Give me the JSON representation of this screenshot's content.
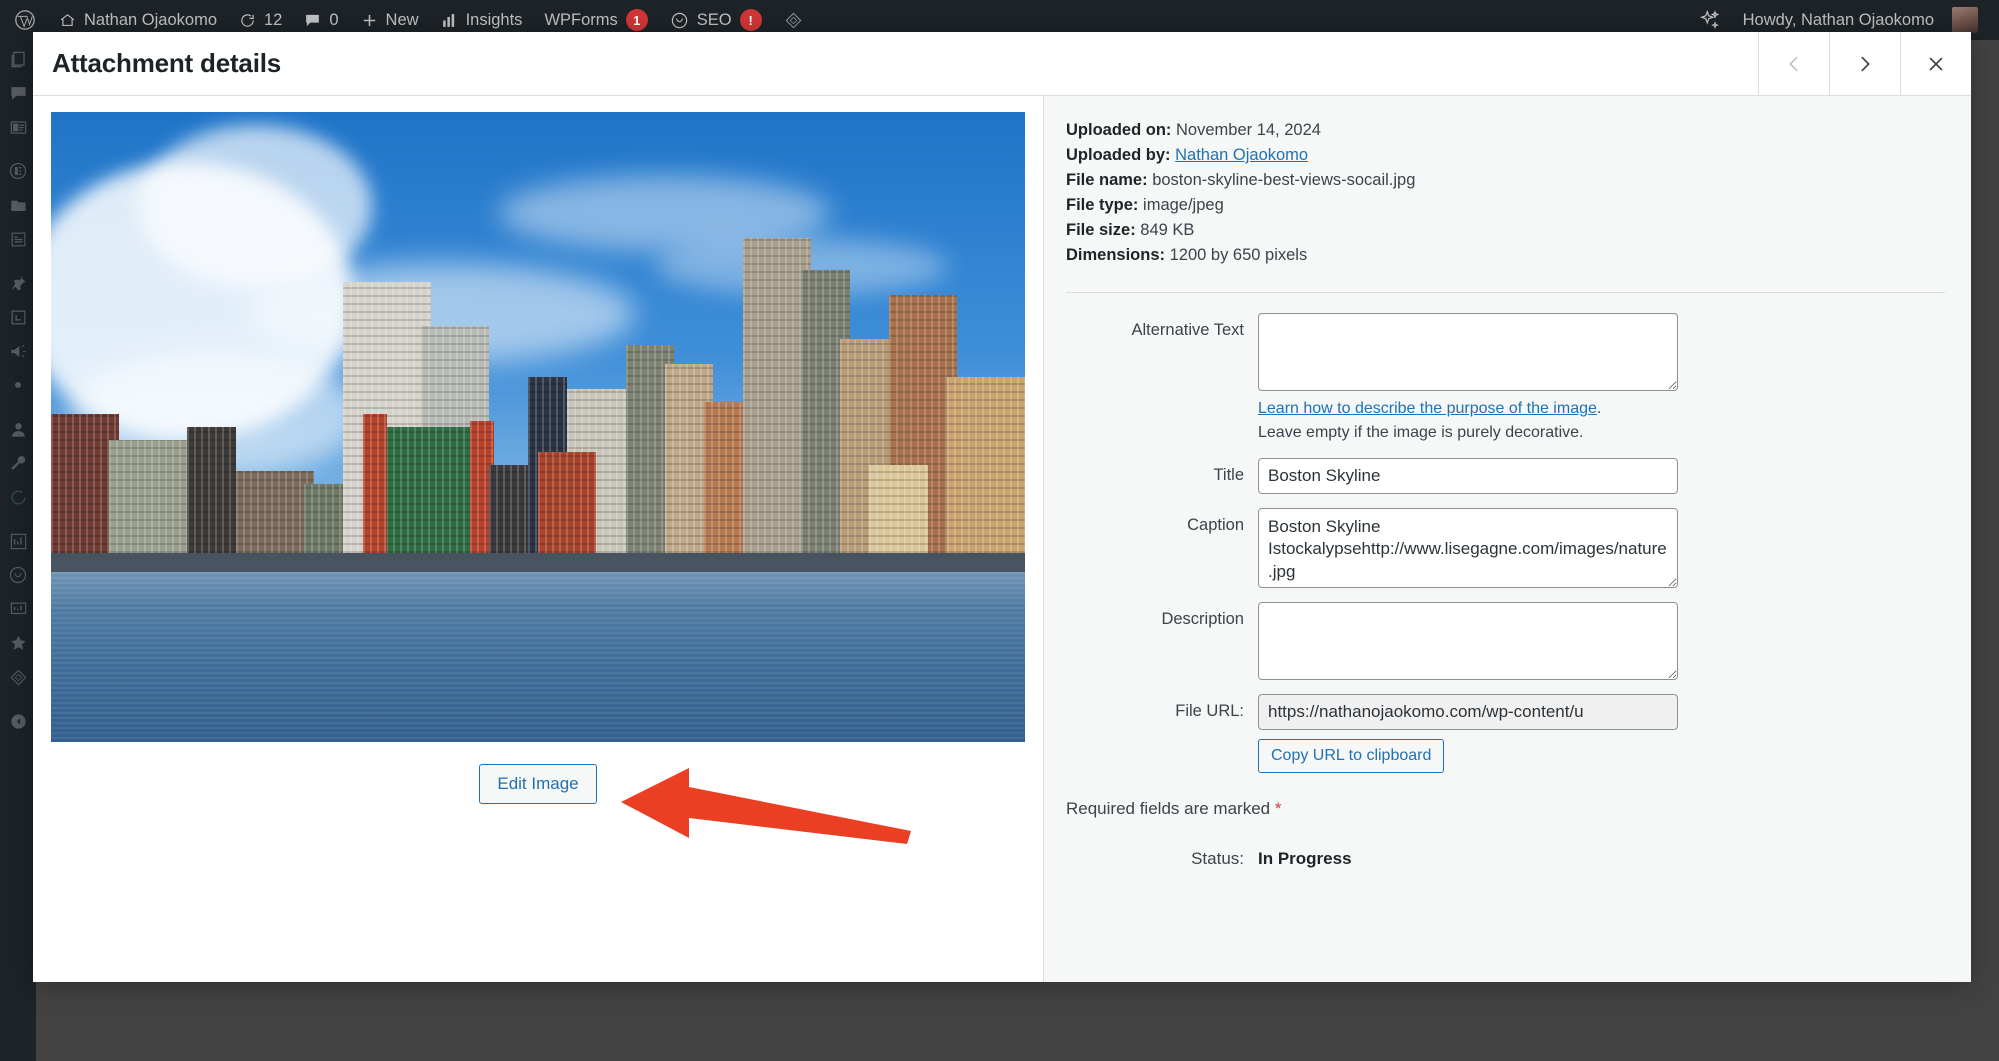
{
  "adminbar": {
    "logo_icon": "wordpress-logo-icon",
    "items": [
      {
        "icon": "home-icon",
        "label": "Nathan Ojaokomo",
        "badge": null
      },
      {
        "icon": "updates-icon",
        "label": "12",
        "badge": null
      },
      {
        "icon": "comment-icon",
        "label": "0",
        "badge": null
      },
      {
        "icon": "plus-icon",
        "label": "New",
        "badge": null
      },
      {
        "icon": "bar-chart-icon",
        "label": "Insights",
        "badge": null
      },
      {
        "icon": null,
        "label": "WPForms",
        "badge": "1"
      },
      {
        "icon": "seo-icon",
        "label": "SEO",
        "badge": "!"
      },
      {
        "icon": "diamond-icon",
        "label": "",
        "badge": null
      }
    ],
    "right": {
      "sparkle_icon": "sparkle-icon",
      "greeting": "Howdy, Nathan Ojaokomo",
      "avatar": "avatar"
    }
  },
  "adminmenu": {
    "items": [
      "pages-icon",
      "comments-icon",
      "forms-icon",
      "elementor-icon",
      "media-icon",
      "list-icon",
      "plugins-icon",
      "appearance-icon",
      "marketing-icon",
      "dot-icon",
      "users-icon",
      "tools-icon",
      "loading-icon",
      "analytics-icon",
      "seo-menu-icon",
      "stats-icon",
      "optimize-icon",
      "diamond-menu-icon",
      "collapse-icon"
    ]
  },
  "modal": {
    "title": "Attachment details",
    "prev_icon": "chevron-left-icon",
    "next_icon": "chevron-right-icon",
    "close_icon": "close-icon",
    "prev_disabled": true
  },
  "preview": {
    "image_alt": "Boston skyline waterfront photograph",
    "edit_button": "Edit Image",
    "annotation_arrow": "red-arrow-annotation"
  },
  "details": {
    "meta": [
      {
        "label": "Uploaded on:",
        "value": "November 14, 2024",
        "link": false
      },
      {
        "label": "Uploaded by:",
        "value": "Nathan Ojaokomo",
        "link": true
      },
      {
        "label": "File name:",
        "value": "boston-skyline-best-views-socail.jpg",
        "link": false
      },
      {
        "label": "File type:",
        "value": "image/jpeg",
        "link": false
      },
      {
        "label": "File size:",
        "value": "849 KB",
        "link": false
      },
      {
        "label": "Dimensions:",
        "value": "1200 by 650 pixels",
        "link": false
      }
    ],
    "fields": {
      "alt_text": {
        "label": "Alternative Text",
        "value": "",
        "placeholder": ""
      },
      "alt_helper_link": "Learn how to describe the purpose of the image",
      "alt_helper_tail": ".",
      "alt_helper_note": "Leave empty if the image is purely decorative.",
      "title": {
        "label": "Title",
        "value": "Boston Skyline"
      },
      "caption": {
        "label": "Caption",
        "value": "Boston Skyline Istockalypsehttp://www.lisegagne.com/images/nature.jpg"
      },
      "description": {
        "label": "Description",
        "value": ""
      },
      "file_url": {
        "label": "File URL:",
        "value": "https://nathanojaokomo.com/wp-content/u"
      },
      "copy_button": "Copy URL to clipboard"
    },
    "required_note": "Required fields are marked",
    "required_mark": "*",
    "status": {
      "label": "Status:",
      "value": "In Progress"
    }
  },
  "colors": {
    "admin_dark": "#1d2327",
    "link_blue": "#2271b1",
    "badge_red": "#d63638",
    "panel_gray": "#f6f7f7",
    "annotation_red": "#ea3f23"
  }
}
